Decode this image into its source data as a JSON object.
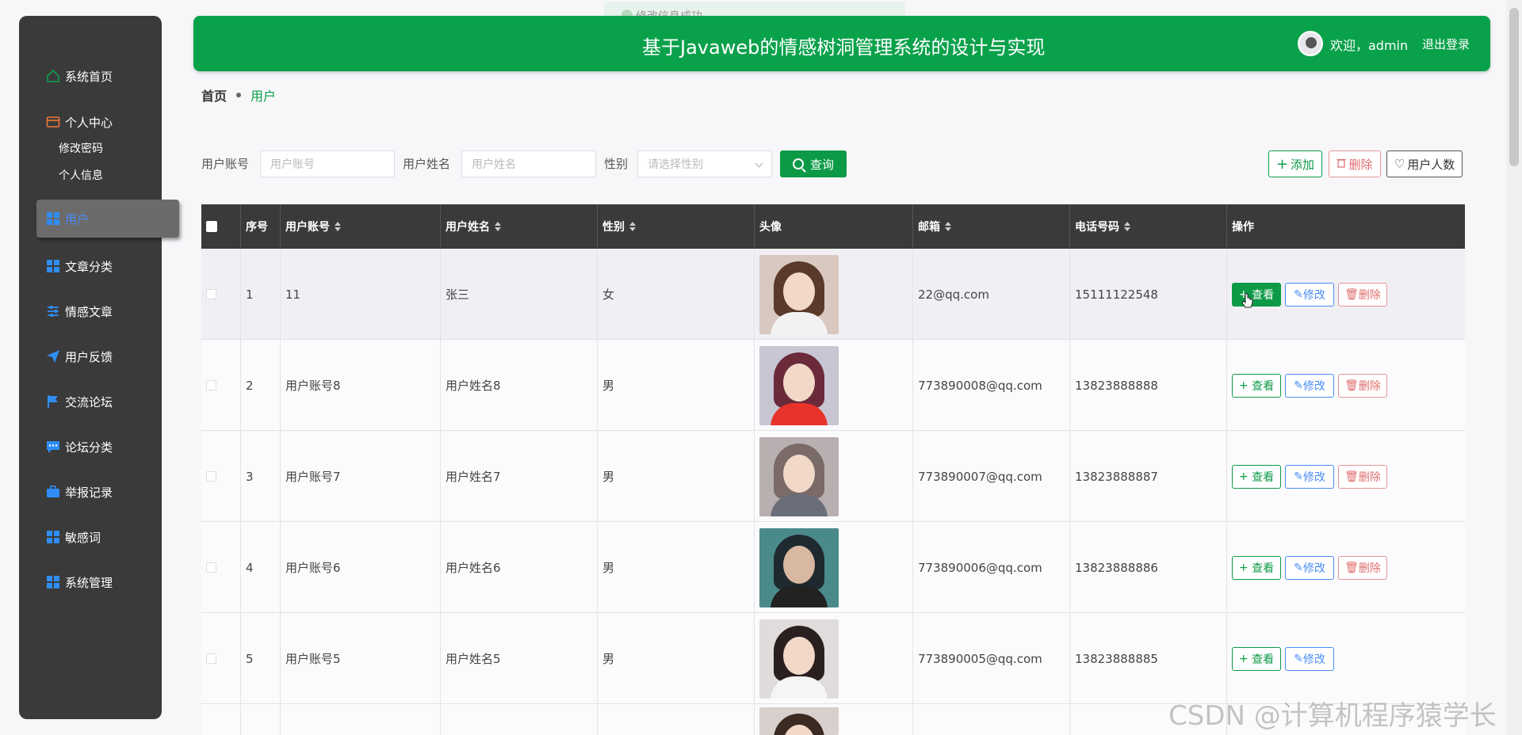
{
  "toast": {
    "text": "修改信息成功"
  },
  "header": {
    "title": "基于Javaweb的情感树洞管理系统的设计与实现",
    "welcome": "欢迎，admin",
    "logout": "退出登录"
  },
  "sidebar": {
    "items": [
      {
        "label": "系统首页",
        "icon": "home-icon"
      },
      {
        "label": "个人中心",
        "icon": "wallet-icon"
      },
      {
        "label": "用户",
        "icon": "grid-icon"
      },
      {
        "label": "文章分类",
        "icon": "grid-icon"
      },
      {
        "label": "情感文章",
        "icon": "sliders-icon"
      },
      {
        "label": "用户反馈",
        "icon": "send-icon"
      },
      {
        "label": "交流论坛",
        "icon": "flag-icon"
      },
      {
        "label": "论坛分类",
        "icon": "chat-icon"
      },
      {
        "label": "举报记录",
        "icon": "briefcase-icon"
      },
      {
        "label": "敏感词",
        "icon": "grid-icon"
      },
      {
        "label": "系统管理",
        "icon": "grid-icon"
      }
    ],
    "sub_items": [
      "修改密码",
      "个人信息"
    ],
    "active": "用户"
  },
  "breadcrumb": {
    "home": "首页",
    "current": "用户"
  },
  "search": {
    "account_label": "用户账号",
    "account_placeholder": "用户账号",
    "name_label": "用户姓名",
    "name_placeholder": "用户姓名",
    "gender_label": "性别",
    "gender_placeholder": "请选择性别",
    "query_label": "查询"
  },
  "actions": {
    "add": "添加",
    "delete": "删除",
    "count": "用户人数"
  },
  "table": {
    "headers": [
      "序号",
      "用户账号",
      "用户姓名",
      "性别",
      "头像",
      "邮箱",
      "电话号码",
      "操作"
    ],
    "rows": [
      {
        "no": "1",
        "account": "11",
        "name": "张三",
        "gender": "女",
        "email": "22@qq.com",
        "phone": "15111122548"
      },
      {
        "no": "2",
        "account": "用户账号8",
        "name": "用户姓名8",
        "gender": "男",
        "email": "773890008@qq.com",
        "phone": "13823888888"
      },
      {
        "no": "3",
        "account": "用户账号7",
        "name": "用户姓名7",
        "gender": "男",
        "email": "773890007@qq.com",
        "phone": "13823888887"
      },
      {
        "no": "4",
        "account": "用户账号6",
        "name": "用户姓名6",
        "gender": "男",
        "email": "773890006@qq.com",
        "phone": "13823888886"
      },
      {
        "no": "5",
        "account": "用户账号5",
        "name": "用户姓名5",
        "gender": "男",
        "email": "773890005@qq.com",
        "phone": "13823888885"
      }
    ],
    "op_view": "查看",
    "op_edit": "修改",
    "op_delete": "删除"
  },
  "watermark": "CSDN @计算机程序猿学长",
  "colors": {
    "primary": "#0aa14b",
    "sidebar": "#3a3a3a",
    "accent_blue": "#2f8df5",
    "danger": "#e06c6c"
  }
}
